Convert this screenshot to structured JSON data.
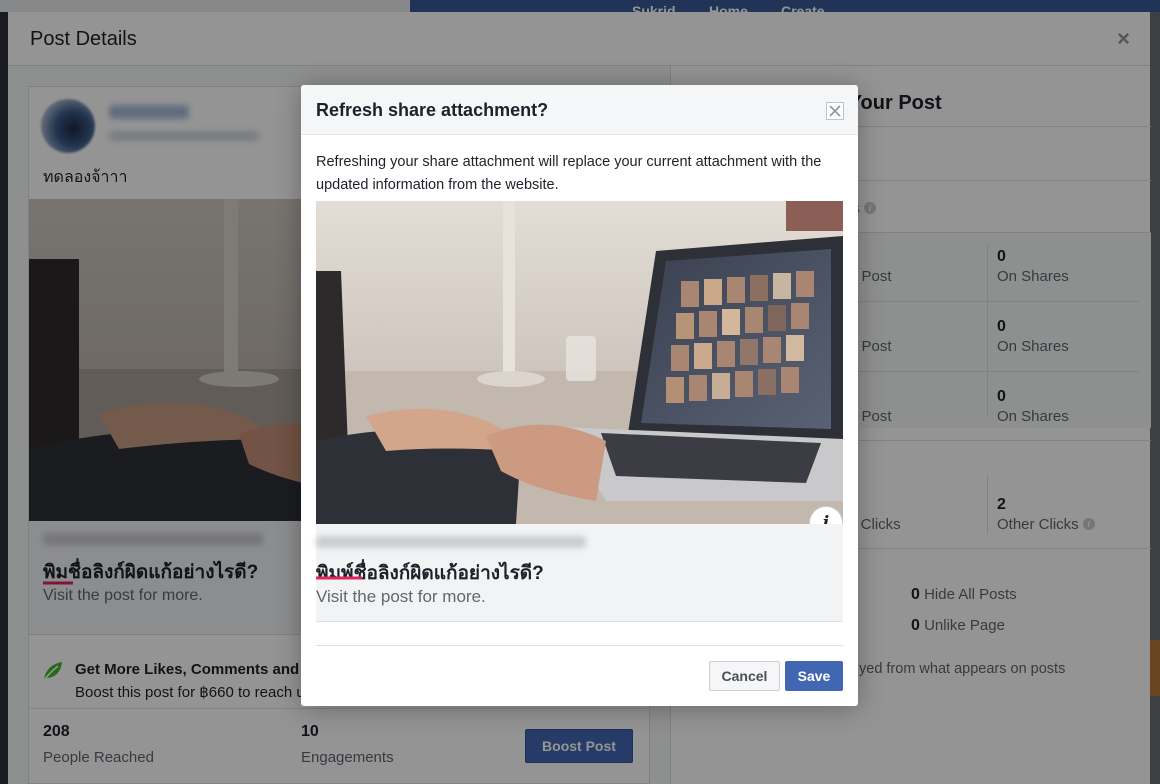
{
  "top_nav": {
    "user_name": "Sukrid",
    "home": "Home",
    "create": "Create"
  },
  "post_details": {
    "title": "Post Details",
    "close_glyph": "×",
    "post_text": "ทดลองจ้าาา",
    "link_title": "พิมชื่อลิงก์ผิดแก้อย่างไรดี?",
    "link_desc": "Visit the post for more.",
    "boost_title": "Get More Likes, Comments and Shares",
    "boost_sub": "Boost this post for ฿660 to reach up to",
    "stats": [
      {
        "value": "208",
        "label": "People Reached"
      },
      {
        "value": "10",
        "label": "Engagements"
      }
    ],
    "boost_button": "Boost Post"
  },
  "performance": {
    "title": "Performance for Your Post",
    "shares_label": "res",
    "rows": [
      {
        "left": "n Post",
        "value": "0",
        "right": "On Shares"
      },
      {
        "left": "n Post",
        "value": "0",
        "right": "On Shares"
      },
      {
        "left": "n Post",
        "value": "0",
        "right": "On Shares"
      }
    ],
    "clicks": {
      "left": "k Clicks",
      "value": "2",
      "right": "Other Clicks"
    },
    "negative": [
      {
        "value": "0",
        "label": "Hide All Posts"
      },
      {
        "value": "0",
        "label": "Unlike Page"
      }
    ],
    "footnote": "yed from what appears on posts"
  },
  "modal": {
    "title": "Refresh share attachment?",
    "description": "Refreshing your share attachment will replace your current attachment with the updated information from the website.",
    "link_title": "พิมพ์ชื่อลิงก์ผิดแก้อย่างไรดี?",
    "link_desc": "Visit the post for more.",
    "info_glyph": "i",
    "cancel": "Cancel",
    "save": "Save"
  },
  "colors": {
    "fb_blue": "#4267b2",
    "topbar_blue": "#3b5998",
    "text_primary": "#1d2129",
    "text_secondary": "#606770",
    "leaf_green": "#42b72a",
    "spell_red": "#e0245e"
  }
}
